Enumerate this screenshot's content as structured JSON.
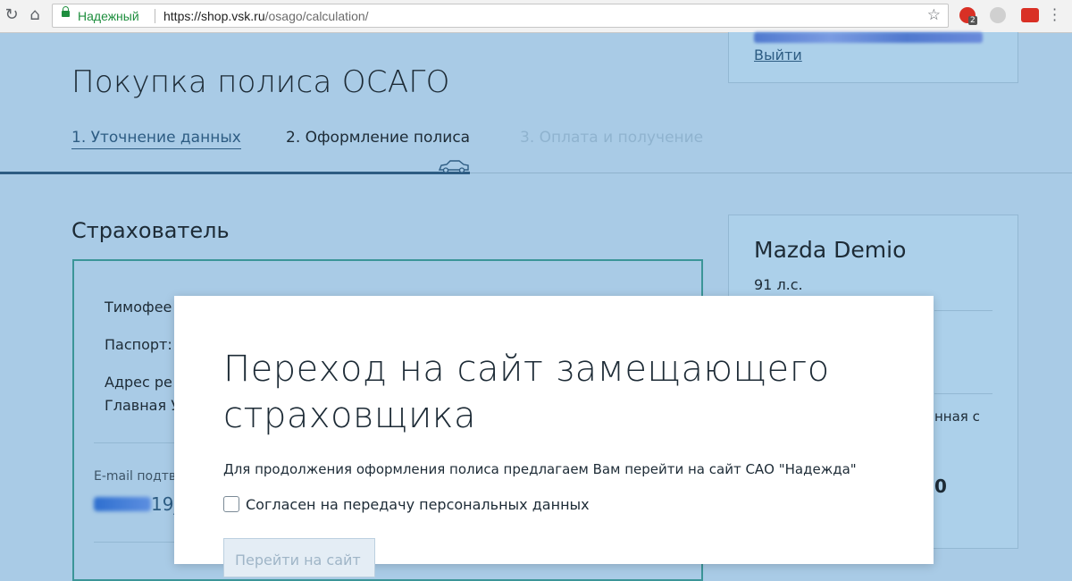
{
  "browser": {
    "secure_label": "Надежный",
    "url_host": "https://shop.vsk.ru",
    "url_path": "/osago/calculation/",
    "ext_badge": "2"
  },
  "page": {
    "title": "Покупка полиса ОСАГО",
    "steps": [
      {
        "label": "1. Уточнение данных",
        "state": "done"
      },
      {
        "label": "2. Оформление полиса",
        "state": "active"
      },
      {
        "label": "3. Оплата и получение",
        "state": "upcoming"
      }
    ]
  },
  "user": {
    "logout_label": "Выйти"
  },
  "insurer": {
    "section_title": "Страхователь",
    "name_partial": "Тимофее",
    "passport_partial": "Паспорт:",
    "address_partial_1": "Адрес ре",
    "address_partial_2": "Главная У",
    "email_label_partial": "E-mail подтв",
    "email_value_partial": "19_"
  },
  "car": {
    "model": "Mazda Demio",
    "power": "91 л.с.",
    "partial_text": "нная с",
    "partial_number": "0"
  },
  "modal": {
    "title": "Переход на сайт замещающего страховщика",
    "text": "Для продолжения оформления полиса предлагаем Вам перейти на сайт САО \"Надежда\"",
    "consent_label": "Согласен на передачу персональных данных",
    "consent_checked": false,
    "go_button_label": "Перейти на сайт"
  },
  "colors": {
    "page_bg": "#a9cbe6",
    "accent": "#2d5c83",
    "card_border_active": "#3b9598",
    "secure_green": "#1e8e3e"
  }
}
